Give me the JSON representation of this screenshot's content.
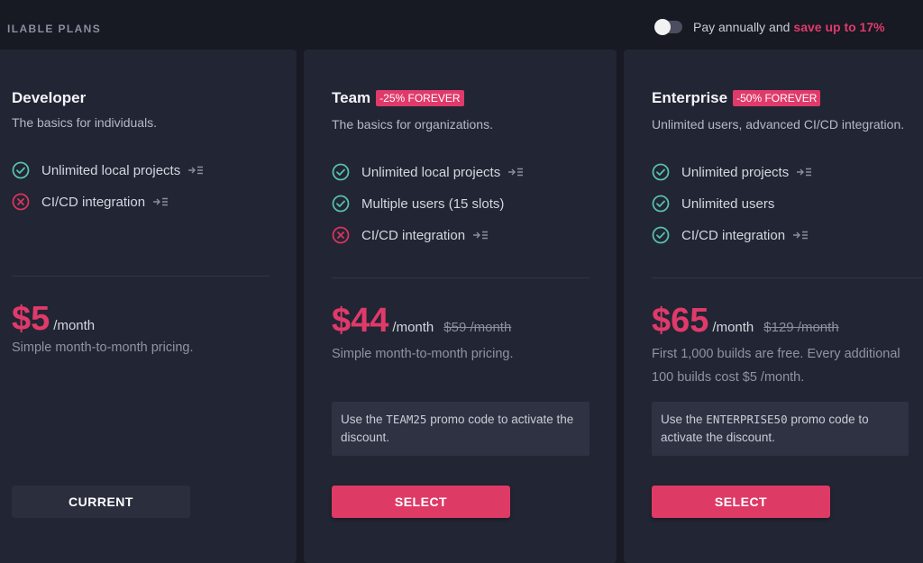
{
  "header": {
    "title": "ILABLE PLANS",
    "billing_text": "Pay annually and",
    "billing_highlight": "save up to 17%"
  },
  "colors": {
    "accent": "#e03a6a",
    "check": "#56c0ad",
    "card": "#222533",
    "background": "#171923"
  },
  "plans": [
    {
      "name": "Developer",
      "badge": "",
      "subtitle": "The basics for individuals.",
      "features": [
        {
          "label": "Unlimited local projects",
          "included": true,
          "icon": "check-circle-icon",
          "has_info": true
        },
        {
          "label": "CI/CD integration",
          "included": false,
          "icon": "x-circle-icon",
          "has_info": true
        }
      ],
      "price": "$5",
      "period": "/month",
      "old_price": "",
      "description": "Simple month-to-month pricing.",
      "promo": null,
      "button": "CURRENT"
    },
    {
      "name": "Team",
      "badge": "-25% FOREVER",
      "subtitle": "The basics for organizations.",
      "features": [
        {
          "label": "Unlimited local projects",
          "included": true,
          "icon": "check-circle-icon",
          "has_info": true
        },
        {
          "label": "Multiple users (15 slots)",
          "included": true,
          "icon": "check-circle-icon",
          "has_info": false
        },
        {
          "label": "CI/CD integration",
          "included": false,
          "icon": "x-circle-icon",
          "has_info": true
        }
      ],
      "price": "$44",
      "period": "/month",
      "old_price": "$59 /month",
      "description": "Simple month-to-month pricing.",
      "promo": {
        "before": "Use the",
        "code": "TEAM25",
        "after": "promo code to activate the discount."
      },
      "button": "SELECT"
    },
    {
      "name": "Enterprise",
      "badge": "-50% FOREVER",
      "subtitle": "Unlimited users, advanced CI/CD integration.",
      "features": [
        {
          "label": "Unlimited projects",
          "included": true,
          "icon": "check-circle-icon",
          "has_info": true
        },
        {
          "label": "Unlimited users",
          "included": true,
          "icon": "check-circle-icon",
          "has_info": false
        },
        {
          "label": "CI/CD integration",
          "included": true,
          "icon": "check-circle-icon",
          "has_info": true
        }
      ],
      "price": "$65",
      "period": "/month",
      "old_price": "$129 /month",
      "description_lines": [
        "First 1,000 builds are free. Every additional",
        "100 builds cost $5 /month."
      ],
      "promo": {
        "before": "Use the",
        "code": "ENTERPRISE50",
        "after": "promo code to activate the discount."
      },
      "button": "SELECT"
    }
  ]
}
